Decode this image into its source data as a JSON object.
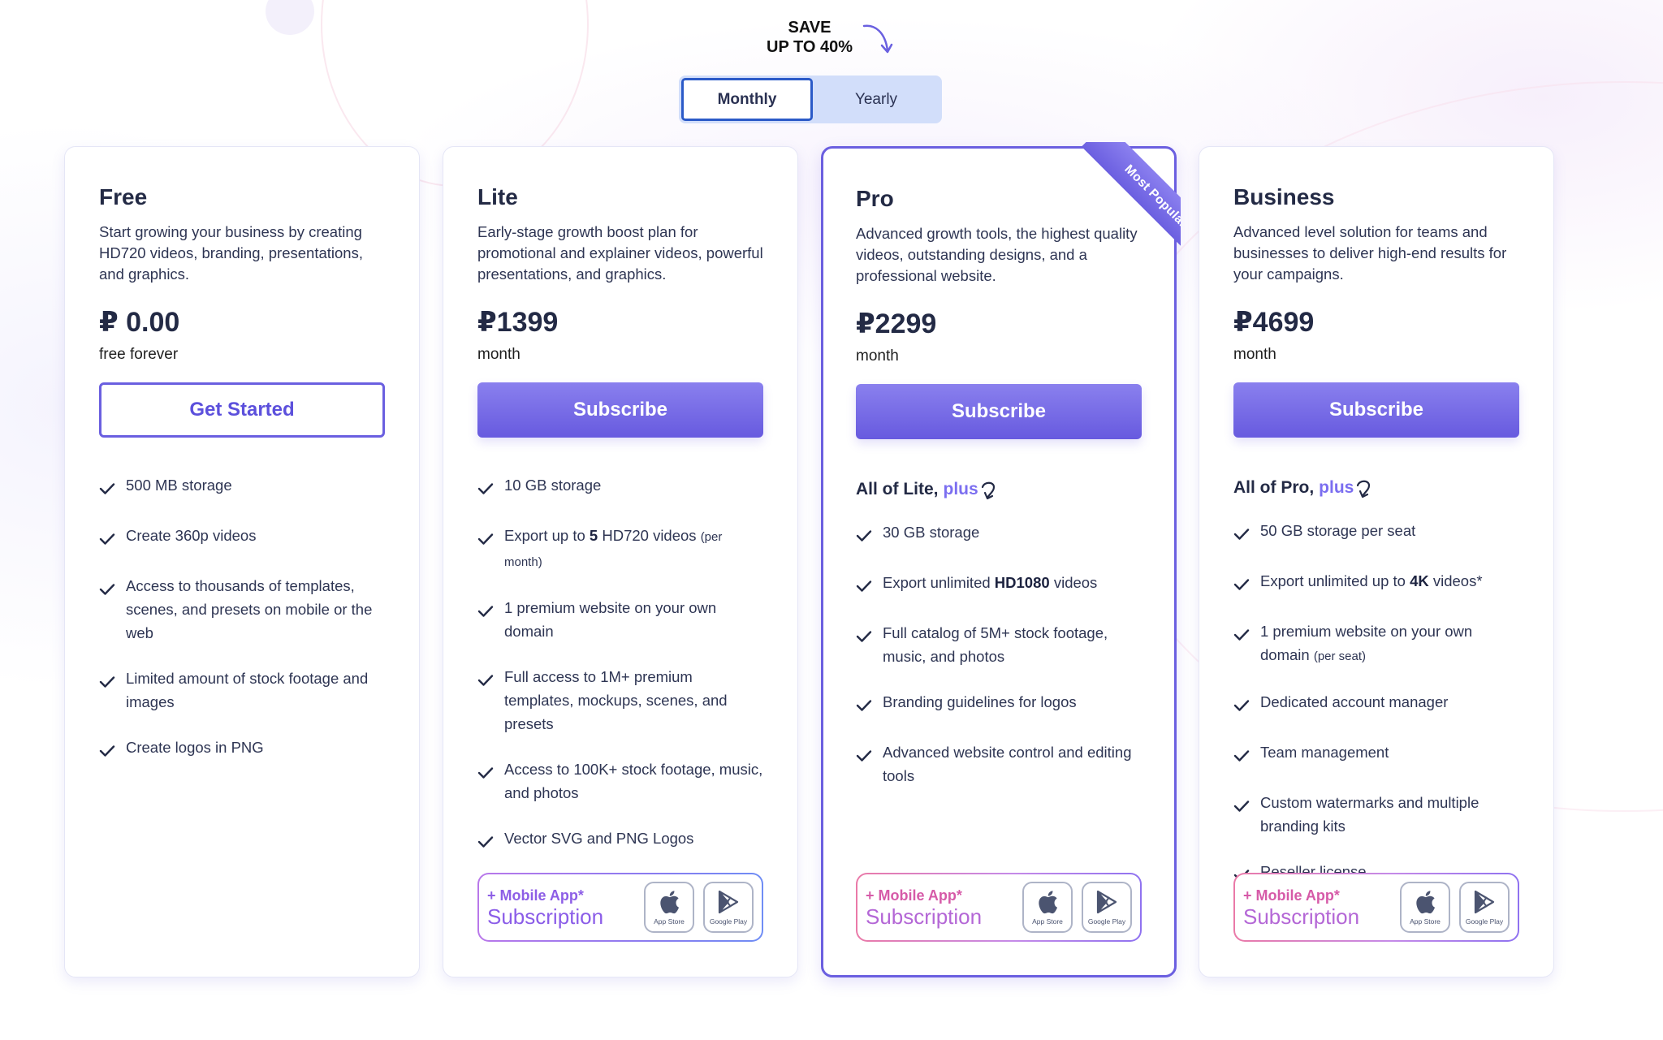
{
  "header": {
    "save_line1": "SAVE",
    "save_line2": "UP TO 40%",
    "billing_toggle": {
      "options": [
        "Monthly",
        "Yearly"
      ],
      "selected": "Monthly"
    }
  },
  "colors": {
    "accent": "#6a5fe0",
    "text_dark": "#232a45",
    "toggle_bg": "#d2defa",
    "toggle_active_border": "#2b5ac8"
  },
  "plans": [
    {
      "name": "Free",
      "description": "Start growing your business by creating HD720 videos, branding, presentations, and graphics.",
      "price": "₽ 0.00",
      "period": "free forever",
      "cta": "Get Started",
      "features": [
        {
          "pre": "500 MB storage"
        },
        {
          "pre": "Create 360p videos"
        },
        {
          "pre": "Access to thousands of templates, scenes, and presets on mobile or the web"
        },
        {
          "pre": "Limited amount of stock footage and images"
        },
        {
          "pre": "Create logos in PNG"
        }
      ]
    },
    {
      "name": "Lite",
      "description": "Early-stage growth boost plan for promotional and explainer videos, powerful presentations, and graphics.",
      "price": "₽1399",
      "period": "month",
      "cta": "Subscribe",
      "features": [
        {
          "pre": "10 GB storage"
        },
        {
          "pre": "Export up to ",
          "bold": "5",
          "post": " HD720 videos ",
          "small": "(per month)"
        },
        {
          "pre": "1 premium website on your own domain"
        },
        {
          "pre": "Full access to 1M+ premium templates, mockups, scenes, and presets"
        },
        {
          "pre": "Access to 100K+ stock footage, music, and photos"
        },
        {
          "pre": "Vector SVG and PNG Logos"
        }
      ],
      "mobile_addon": {
        "line1": "+ Mobile App*",
        "line2": "Subscription",
        "app_store": "App Store",
        "google_play": "Google Play"
      }
    },
    {
      "name": "Pro",
      "badge": "Most Popular",
      "description": "Advanced growth tools, the highest quality videos, outstanding designs, and a professional website.",
      "price": "₽2299",
      "period": "month",
      "cta": "Subscribe",
      "includes_prefix": "All of Lite,",
      "includes_plus": "plus",
      "features": [
        {
          "pre": "30 GB storage"
        },
        {
          "pre": "Export unlimited ",
          "bold": "HD1080",
          "post": " videos"
        },
        {
          "pre": "Full catalog of 5M+ stock footage, music, and photos"
        },
        {
          "pre": "Branding guidelines for logos"
        },
        {
          "pre": "Advanced website control and editing tools"
        }
      ],
      "mobile_addon": {
        "line1": "+ Mobile App*",
        "line2": "Subscription",
        "app_store": "App Store",
        "google_play": "Google Play"
      }
    },
    {
      "name": "Business",
      "description": "Advanced level solution for teams and businesses to deliver high-end results for your campaigns.",
      "price": "₽4699",
      "period": "month",
      "cta": "Subscribe",
      "includes_prefix": "All of Pro,",
      "includes_plus": "plus",
      "features": [
        {
          "pre": "50 GB storage per seat"
        },
        {
          "pre": "Export unlimited up to ",
          "bold": "4K",
          "post": " videos*"
        },
        {
          "pre": "1 premium website on your own domain ",
          "small": "(per seat)"
        },
        {
          "pre": "Dedicated account manager"
        },
        {
          "pre": "Team management"
        },
        {
          "pre": "Custom watermarks and multiple branding kits"
        },
        {
          "pre": "Reseller license"
        }
      ],
      "mobile_addon": {
        "line1": "+ Mobile App*",
        "line2": "Subscription",
        "app_store": "App Store",
        "google_play": "Google Play"
      }
    }
  ]
}
